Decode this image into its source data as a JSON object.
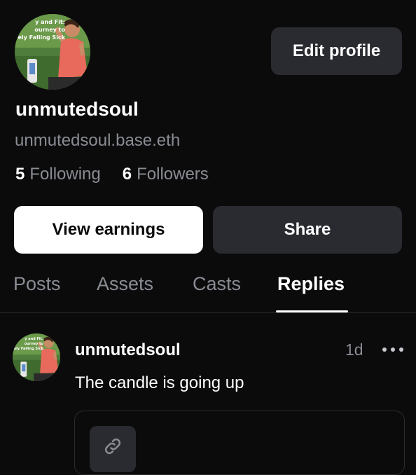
{
  "profile": {
    "display_name": "unmutedsoul",
    "handle": "unmutedsoul.base.eth",
    "avatar_text": [
      "y and Fit:",
      "ourney to",
      "ely Falling Sick"
    ],
    "edit_label": "Edit profile",
    "following_count": "5",
    "following_label": "Following",
    "followers_count": "6",
    "followers_label": "Followers"
  },
  "actions": {
    "earnings_label": "View earnings",
    "share_label": "Share"
  },
  "tabs": [
    {
      "label": "Posts",
      "active": false
    },
    {
      "label": "Assets",
      "active": false
    },
    {
      "label": "Casts",
      "active": false
    },
    {
      "label": "Replies",
      "active": true
    }
  ],
  "reply": {
    "author": "unmutedsoul",
    "time": "1d",
    "text": "The candle is going up",
    "embed_icon": "link-icon"
  },
  "colors": {
    "background": "#0b0b0c",
    "muted_text": "#8a8c93",
    "button_dark": "#2a2b30",
    "button_light": "#ffffff"
  }
}
